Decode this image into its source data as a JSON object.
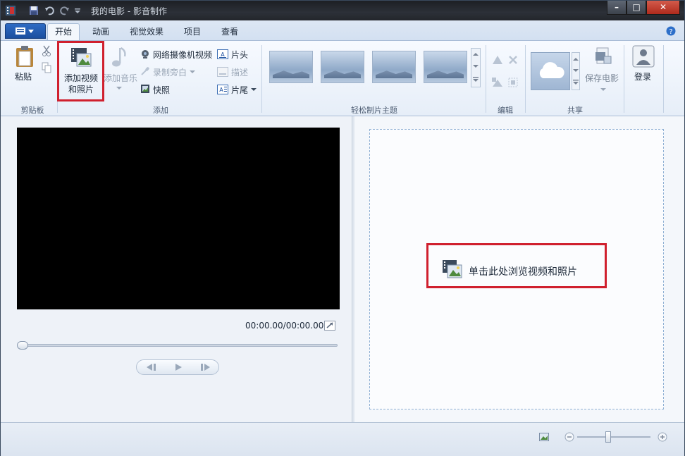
{
  "window": {
    "title": "我的电影 - 影音制作",
    "min_label": "–",
    "max_label": "□",
    "close_label": "✕"
  },
  "tabs": [
    "开始",
    "动画",
    "视觉效果",
    "项目",
    "查看"
  ],
  "ribbon": {
    "clipboard": {
      "paste": "粘贴",
      "group": "剪贴板"
    },
    "add": {
      "add_videos_line1": "添加视频",
      "add_videos_line2": "和照片",
      "add_music": "添加音乐",
      "webcam": "网络摄像机视频",
      "narration": "录制旁白",
      "snapshot": "快照",
      "title": "片头",
      "caption": "描述",
      "credits": "片尾",
      "group": "添加"
    },
    "themes": {
      "group": "轻松制片主题"
    },
    "editing": {
      "group": "编辑"
    },
    "share": {
      "save_movie": "保存电影",
      "group": "共享"
    },
    "signin": {
      "label": "登录"
    }
  },
  "preview": {
    "timecode": "00:00.00/00:00.00"
  },
  "storyboard": {
    "browse_text": "单击此处浏览视频和照片"
  },
  "colors": {
    "highlight": "#d0202e",
    "accent": "#1b4f9f"
  }
}
